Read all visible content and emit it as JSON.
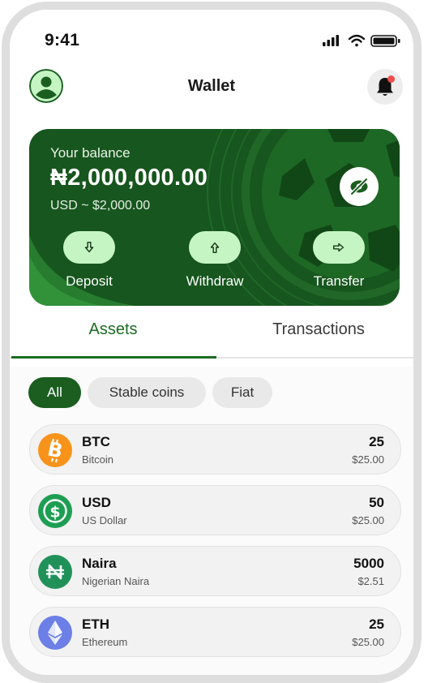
{
  "status_bar": {
    "time": "9:41"
  },
  "header": {
    "title": "Wallet"
  },
  "balance_card": {
    "label": "Your balance",
    "amount": "₦2,000,000.00",
    "usd": "USD ~ $2,000.00",
    "actions": [
      {
        "label": "Deposit",
        "icon": "arrow-down-icon"
      },
      {
        "label": "Withdraw",
        "icon": "arrow-up-icon"
      },
      {
        "label": "Transfer",
        "icon": "arrow-right-icon"
      }
    ]
  },
  "tabs": [
    {
      "label": "Assets",
      "active": true
    },
    {
      "label": "Transactions",
      "active": false
    }
  ],
  "filters": [
    {
      "label": "All",
      "selected": true
    },
    {
      "label": "Stable coins",
      "selected": false
    },
    {
      "label": "Fiat",
      "selected": false
    }
  ],
  "assets": [
    {
      "symbol": "BTC",
      "name": "Bitcoin",
      "amount": "25",
      "value": "$25.00",
      "icon": "bitcoin-icon",
      "color": "#f7931a"
    },
    {
      "symbol": "USD",
      "name": "US Dollar",
      "amount": "50",
      "value": "$25.00",
      "icon": "dollar-icon",
      "color": "#1e9e53"
    },
    {
      "symbol": "Naira",
      "name": "Nigerian Naira",
      "amount": "5000",
      "value": "$2.51",
      "icon": "naira-icon",
      "color": "#21915a"
    },
    {
      "symbol": "ETH",
      "name": "Ethereum",
      "amount": "25",
      "value": "$25.00",
      "icon": "ethereum-icon",
      "color": "#6b7fe6"
    }
  ],
  "colors": {
    "brand_green": "#1b5e20",
    "card_green": "#17561e",
    "action_pill": "#c6f5c4",
    "notification_dot": "#ef4c4c"
  }
}
